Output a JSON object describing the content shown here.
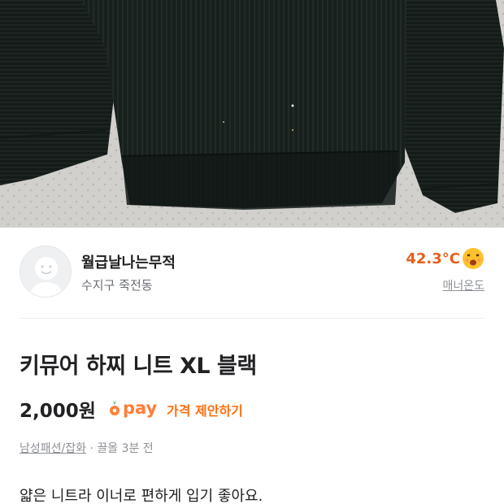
{
  "product_image": {
    "icon": "black-knit-sweater-photo"
  },
  "seller": {
    "avatar_icon": "default-profile-icon",
    "name": "월급날나는무적",
    "region": "수지구 죽전동",
    "temperature": "42.3°C",
    "temperature_icon": "happy-face-icon",
    "manner_label": "매너온도"
  },
  "listing": {
    "title": "키뮤어 하찌 니트 XL 블랙",
    "price": "2,000원",
    "pay_icon": "carrot-pay-icon",
    "pay_label": "pay",
    "offer_label": "가격 제안하기",
    "category": "남성패션/잡화",
    "meta_separator": " · ",
    "posted": "끌올 3분 전",
    "description": "얇은 니트라 이너로 편하게 입기 좋아요."
  },
  "colors": {
    "brand": "#ff6f0f",
    "temperature": "#e5601d",
    "text": "#212124",
    "muted": "#8d9096"
  }
}
